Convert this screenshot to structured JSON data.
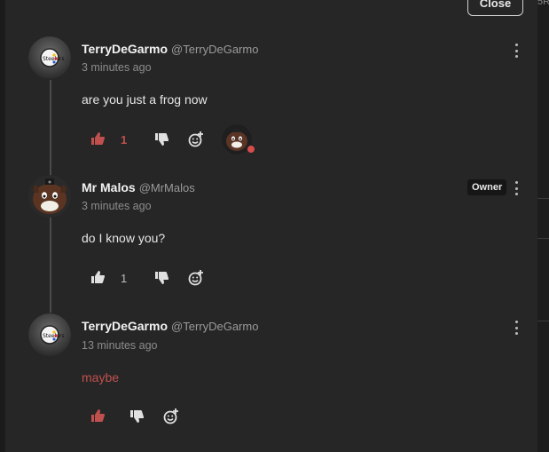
{
  "dialog": {
    "close_label": "Close"
  },
  "strip_glyph": "5R",
  "colors": {
    "liked": "#c0504d",
    "neutral": "#e0e0e0",
    "panel": "#262626"
  },
  "comments": [
    {
      "author": "TerryDeGarmo",
      "handle": "@TerryDeGarmo",
      "time": "3 minutes ago",
      "text": "are you just a frog now",
      "likes": "1",
      "liked": true,
      "avatar_icon": "steelers-logo-icon",
      "has_reaction": true,
      "reaction_icon": "mr-malos-face-icon"
    },
    {
      "author": "Mr Malos",
      "handle": "@MrMalos",
      "time": "3 minutes ago",
      "text": "do I know you?",
      "likes": "1",
      "liked": false,
      "badge": "Owner",
      "avatar_icon": "mr-malos-face-icon"
    },
    {
      "author": "TerryDeGarmo",
      "handle": "@TerryDeGarmo",
      "time": "13 minutes ago",
      "text": "maybe",
      "likes": "",
      "liked": true,
      "avatar_icon": "steelers-logo-icon"
    }
  ]
}
